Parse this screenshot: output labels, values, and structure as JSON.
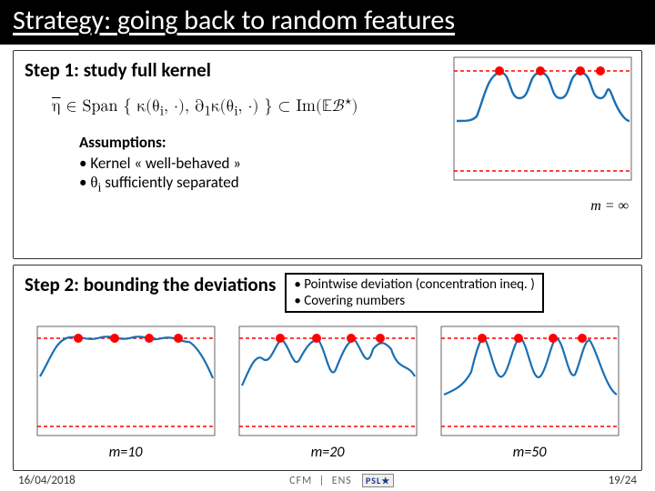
{
  "title": "Strategy: going back to random features",
  "step1": {
    "heading": "Step 1: study full kernel",
    "formula_text": "η̄ ∈ Span { κ(θᵢ, ·), ∂₁κ(θᵢ, ·) } ⊂ Im(𝔼ℬ⋆)",
    "assumptions_head": "Assumptions:",
    "bullet1": "Kernel « well-behaved »",
    "bullet2_prefix": "θᵢ",
    "bullet2_suffix": " sufficiently separated",
    "plot_cap": "m = ∞"
  },
  "step2": {
    "heading": "Step 2: bounding the deviations",
    "box_line1": "Pointwise deviation (concentration ineq. )",
    "box_line2": "Covering numbers",
    "cap10": "m=10",
    "cap20": "m=20",
    "cap50": "m=50"
  },
  "footer": {
    "date": "16/04/2018",
    "page": "19/24",
    "logo1": "CFM",
    "logo2": "ENS",
    "logo3": "PSL★"
  },
  "chart_data": [
    {
      "type": "line",
      "name": "m-infinity",
      "title": "m = ∞",
      "x_range": [
        0,
        200
      ],
      "y_range": [
        -1,
        1.05
      ],
      "upper_ref": 1.0,
      "lower_ref": -1.0,
      "peaks_x": [
        50,
        90,
        130,
        165
      ],
      "curve_description": "Smooth kernel envelope: ≈1 plateau on [30,175], dips to ≈0 outside, four touching maxima at peaks_x",
      "series": [
        {
          "name": "curve",
          "y": [
            0.0,
            0.1,
            0.4,
            0.9,
            1.0,
            0.8,
            1.0,
            0.8,
            1.0,
            0.8,
            1.0,
            0.9,
            0.4,
            0.1,
            0.0
          ]
        }
      ]
    },
    {
      "type": "line",
      "name": "m-10",
      "title": "m=10",
      "x_range": [
        0,
        200
      ],
      "y_range": [
        -1,
        1.1
      ],
      "upper_ref": 1.0,
      "lower_ref": -1.0,
      "peaks_x": [
        48,
        85,
        120,
        155
      ],
      "curve_description": "Plateau near 1 across [35,165] with small wiggles, slight overshoot >1, drops to ≈0.3 at edges",
      "series": [
        {
          "name": "curve",
          "y": [
            0.3,
            0.8,
            1.02,
            0.98,
            1.03,
            0.99,
            1.02,
            0.97,
            1.0,
            0.8,
            0.3
          ]
        }
      ]
    },
    {
      "type": "line",
      "name": "m-20",
      "title": "m=20",
      "x_range": [
        0,
        200
      ],
      "y_range": [
        -1,
        1.1
      ],
      "upper_ref": 1.0,
      "lower_ref": -1.0,
      "peaks_x": [
        48,
        85,
        120,
        155
      ],
      "curve_description": "Noisy oscillation around ≈0.6 with peaks reaching 1.0 near peaks_x, dips to ≈0.1; edges ≈0.2",
      "series": [
        {
          "name": "curve",
          "y": [
            0.2,
            0.6,
            1.0,
            0.4,
            0.9,
            0.2,
            1.0,
            0.5,
            0.95,
            0.3,
            0.9,
            0.2,
            0.7,
            0.3
          ]
        }
      ]
    },
    {
      "type": "line",
      "name": "m-50",
      "title": "m=50",
      "x_range": [
        0,
        200
      ],
      "y_range": [
        -1,
        1.1
      ],
      "upper_ref": 1.0,
      "lower_ref": -1.0,
      "peaks_x": [
        48,
        85,
        120,
        155
      ],
      "curve_description": "Four clear sharp peaks at peaks_x reaching 1.0, baseline ≈0.15, edges ≈0",
      "series": [
        {
          "name": "curve",
          "y": [
            0.0,
            0.1,
            1.0,
            0.15,
            1.0,
            0.1,
            1.0,
            0.15,
            1.0,
            0.1,
            0.0
          ]
        }
      ]
    }
  ]
}
